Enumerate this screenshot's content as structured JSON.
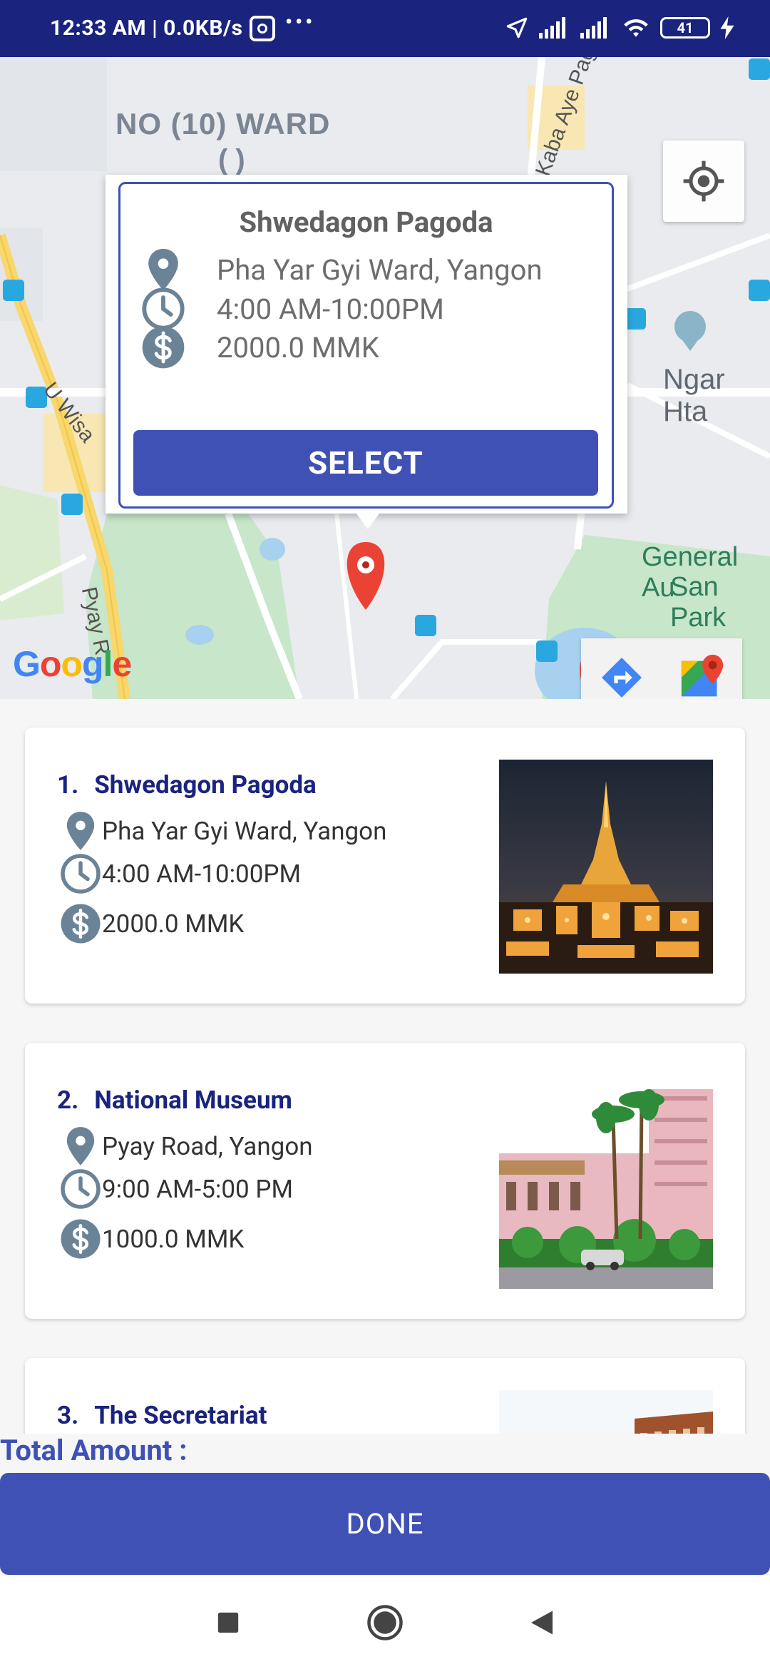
{
  "status_bar": {
    "time_text": "12:33 AM | 0.0KB/s",
    "dots": "•••",
    "battery": "41"
  },
  "map": {
    "labels": {
      "ward": "NO (10) WARD",
      "ward_sub": "( )",
      "road1": "U Wisa",
      "road2": "Pyay R",
      "road3": "Kaba Aye Pagoda Road",
      "ngar": "Ngar Hta",
      "general": "General Au",
      "san": "San Park"
    },
    "google": [
      "G",
      "o",
      "o",
      "g",
      "l",
      "e"
    ],
    "colors": {
      "road_major": "#f7d76e",
      "park": "#c8e6c9",
      "water": "#a8d1f0",
      "land": "#e9ebee",
      "pin": "#ea4335"
    }
  },
  "popup": {
    "title": "Shwedagon Pagoda",
    "address": "Pha Yar Gyi Ward, Yangon",
    "hours": "4:00 AM-10:00PM",
    "price": "2000.0  MMK",
    "select_label": "SELECT"
  },
  "places": [
    {
      "num": "1.",
      "name": "Shwedagon Pagoda",
      "address": "Pha Yar Gyi Ward, Yangon",
      "hours": "4:00 AM-10:00PM",
      "price": "2000.0   MMK"
    },
    {
      "num": "2.",
      "name": "National Museum",
      "address": "Pyay Road, Yangon",
      "hours": "9:00 AM-5:00 PM",
      "price": "1000.0   MMK"
    },
    {
      "num": "3.",
      "name": "The Secretariat",
      "address": "",
      "hours": "",
      "price": ""
    }
  ],
  "footer": {
    "total_label": "Total Amount :",
    "done_label": "DONE"
  },
  "colors": {
    "primary": "#3f51b5",
    "primary_dark": "#1a237e",
    "icon": "#6b8396"
  },
  "icons": {
    "pin": "location-pin-icon",
    "clock": "clock-icon",
    "dollar": "dollar-icon"
  }
}
